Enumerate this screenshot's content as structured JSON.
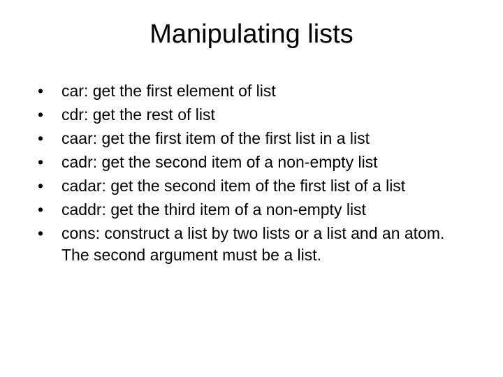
{
  "title": "Manipulating lists",
  "items": [
    {
      "term": "car",
      "desc": ": get the first element of list"
    },
    {
      "term": "cdr",
      "desc": ": get the rest of list"
    },
    {
      "term": "caar",
      "desc": ": get the first item of the first list in a list"
    },
    {
      "term": "cadr",
      "desc": ": get the second item of a non-empty list"
    },
    {
      "term": "cadar",
      "desc": ": get the second item of the first list of a list"
    },
    {
      "term": "caddr",
      "desc": ": get the third item of a non-empty list"
    },
    {
      "term": "cons",
      "desc": ": construct a list by two lists or a list and an atom. The second argument must be a list."
    }
  ]
}
